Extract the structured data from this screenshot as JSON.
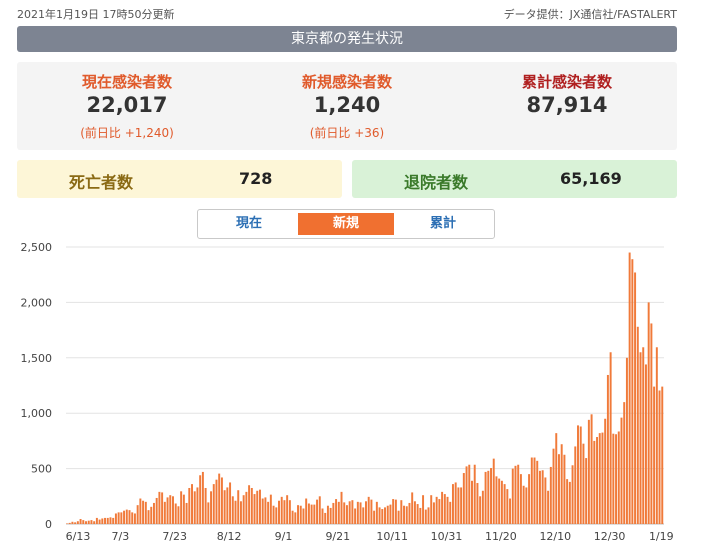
{
  "header": {
    "updated": "2021年1月19日 17時50分更新",
    "source": "データ提供：JX通信社/FASTALERT",
    "banner": "東京都の発生状況"
  },
  "stats": {
    "current": {
      "label": "現在感染者数",
      "value": "22,017",
      "compare": "(前日比 +1,240)",
      "color": "#e05a2b"
    },
    "new": {
      "label": "新規感染者数",
      "value": "1,240",
      "compare": "(前日比 +36)",
      "color": "#e05a2b"
    },
    "total": {
      "label": "累計感染者数",
      "value": "87,914",
      "color": "#b02020"
    }
  },
  "deaths": {
    "label": "死亡者数",
    "value": "728"
  },
  "discharged": {
    "label": "退院者数",
    "value": "65,169"
  },
  "tabs": [
    {
      "label": "現在",
      "active": false
    },
    {
      "label": "新規",
      "active": true
    },
    {
      "label": "累計",
      "active": false
    }
  ],
  "chart_data": {
    "type": "bar",
    "x_start": "6/13",
    "x_ticks": [
      "6/13",
      "7/3",
      "7/23",
      "8/12",
      "9/1",
      "9/21",
      "10/11",
      "10/31",
      "11/20",
      "12/10",
      "12/30",
      "1/19"
    ],
    "y_ticks": [
      0,
      500,
      1000,
      1500,
      2000,
      2500
    ],
    "ylim": [
      0,
      2500
    ],
    "grid": true,
    "color": "#f07a3a",
    "values": [
      5,
      10,
      20,
      15,
      25,
      45,
      35,
      25,
      30,
      35,
      25,
      55,
      40,
      50,
      55,
      55,
      60,
      55,
      95,
      105,
      105,
      120,
      130,
      125,
      105,
      95,
      170,
      230,
      210,
      200,
      125,
      155,
      190,
      235,
      290,
      285,
      200,
      240,
      260,
      250,
      185,
      160,
      295,
      265,
      190,
      325,
      360,
      295,
      330,
      440,
      470,
      325,
      195,
      295,
      360,
      400,
      455,
      420,
      305,
      330,
      375,
      250,
      210,
      305,
      205,
      260,
      290,
      350,
      325,
      270,
      300,
      310,
      230,
      240,
      200,
      265,
      165,
      150,
      210,
      245,
      215,
      260,
      215,
      120,
      105,
      170,
      165,
      140,
      230,
      185,
      175,
      175,
      220,
      250,
      140,
      100,
      165,
      145,
      190,
      225,
      200,
      290,
      195,
      170,
      205,
      215,
      140,
      200,
      195,
      150,
      205,
      245,
      220,
      120,
      200,
      150,
      135,
      150,
      165,
      175,
      225,
      220,
      120,
      215,
      165,
      160,
      190,
      285,
      205,
      180,
      145,
      260,
      130,
      150,
      260,
      195,
      245,
      225,
      290,
      270,
      245,
      200,
      360,
      375,
      330,
      330,
      460,
      520,
      535,
      390,
      535,
      370,
      250,
      300,
      470,
      480,
      505,
      590,
      430,
      410,
      390,
      360,
      315,
      230,
      500,
      525,
      535,
      450,
      345,
      330,
      450,
      600,
      600,
      570,
      480,
      485,
      420,
      300,
      515,
      680,
      820,
      630,
      720,
      625,
      405,
      380,
      530,
      700,
      890,
      880,
      725,
      595,
      940,
      990,
      750,
      785,
      820,
      825,
      950,
      1345,
      1550,
      815,
      810,
      835,
      960,
      1100,
      1500,
      2450,
      2390,
      2270,
      1780,
      1550,
      1595,
      1440,
      2000,
      1810,
      1240,
      1595,
      1205,
      1240
    ]
  }
}
